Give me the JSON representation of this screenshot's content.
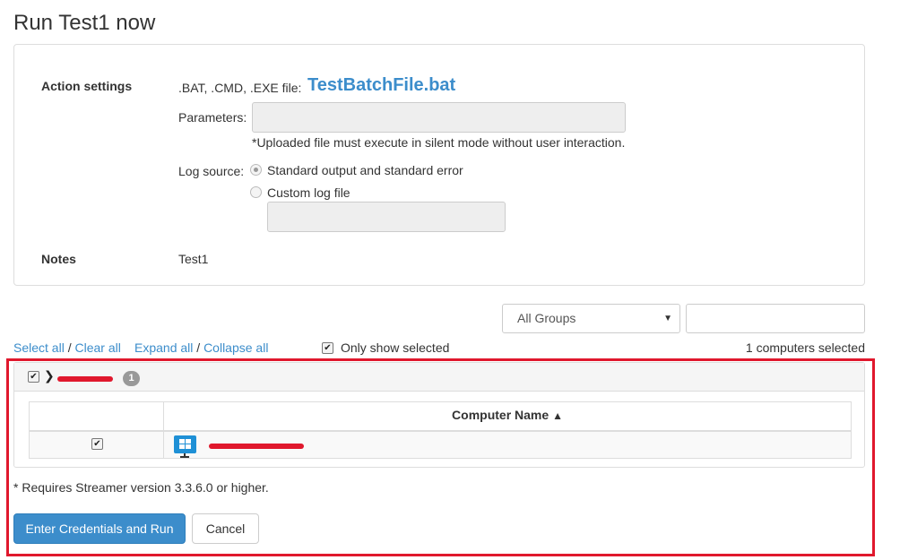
{
  "page": {
    "title": "Run Test1 now"
  },
  "action_settings": {
    "section_label": "Action settings",
    "file_label": ".BAT, .CMD, .EXE file:",
    "file_name": "TestBatchFile.bat",
    "parameters_label": "Parameters:",
    "parameters_value": "",
    "silent_note": "*Uploaded file must execute in silent mode without user interaction.",
    "log_source_label": "Log source:",
    "log_options": [
      {
        "label": "Standard output and standard error",
        "selected": true
      },
      {
        "label": "Custom log file",
        "selected": false
      }
    ],
    "custom_log_value": ""
  },
  "notes": {
    "label": "Notes",
    "value": "Test1"
  },
  "filters": {
    "group_select_value": "All Groups",
    "search_value": "",
    "select_all": "Select all",
    "clear_all": "Clear all",
    "expand_all": "Expand all",
    "collapse_all": "Collapse all",
    "separator": "/",
    "only_show_selected_label": "Only show selected",
    "only_show_selected_checked": true,
    "selected_count_text": "1 computers selected"
  },
  "group": {
    "checked": true,
    "count_badge": "1",
    "table": {
      "column_header": "Computer Name",
      "rows": [
        {
          "checked": true
        }
      ]
    }
  },
  "footer": {
    "requirement_note": "* Requires Streamer version 3.3.6.0 or higher.",
    "run_button": "Enter Credentials and Run",
    "cancel_button": "Cancel"
  },
  "colors": {
    "accent": "#3c8dcb",
    "highlight_frame": "#e0182d",
    "redaction": "#e0182d"
  }
}
